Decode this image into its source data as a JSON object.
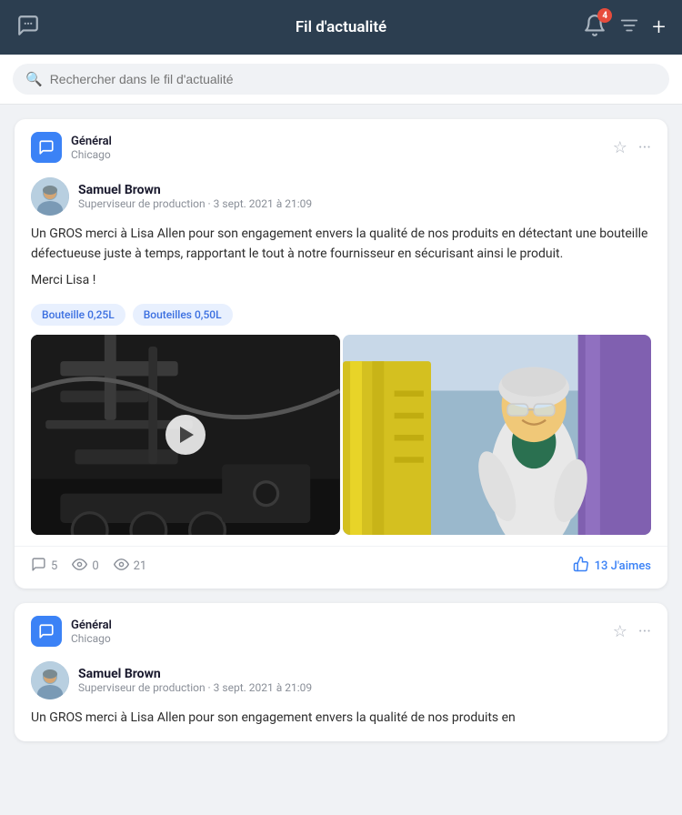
{
  "header": {
    "title": "Fil d'actualité",
    "notification_count": "4"
  },
  "search": {
    "placeholder": "Rechercher dans le fil d'actualité"
  },
  "post1": {
    "channel_name": "Général",
    "channel_sub": "Chicago",
    "author_name": "Samuel Brown",
    "author_role": "Superviseur de production",
    "author_date": "3 sept. 2021 à 21:09",
    "body_text": "Un GROS merci à Lisa Allen pour son engagement envers la qualité de nos produits en détectant une bouteille défectueuse juste à temps, rapportant le tout à notre fournisseur en sécurisant ainsi le produit.",
    "body_thanks": "Merci Lisa !",
    "tags": [
      "Bouteille 0,25L",
      "Bouteilles 0,50L"
    ],
    "stats": {
      "comments": "5",
      "views1": "0",
      "views2": "21",
      "likes": "13 J'aimes"
    }
  },
  "post2": {
    "channel_name": "Général",
    "channel_sub": "Chicago",
    "author_name": "Samuel Brown",
    "author_role": "Superviseur de production",
    "author_date": "3 sept. 2021 à 21:09",
    "body_text": "Un GROS merci à Lisa Allen pour son engagement envers la qualité de nos produits en"
  }
}
